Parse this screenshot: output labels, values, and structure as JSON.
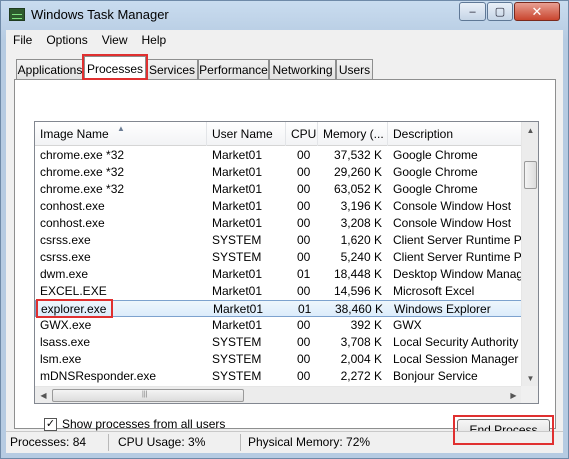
{
  "window": {
    "title": "Windows Task Manager"
  },
  "caption_buttons": {
    "minimize": "–",
    "maximize": "▢",
    "close": "✕"
  },
  "menu": [
    "File",
    "Options",
    "View",
    "Help"
  ],
  "tabs": [
    "Applications",
    "Processes",
    "Services",
    "Performance",
    "Networking",
    "Users"
  ],
  "active_tab": "Processes",
  "columns": [
    "Image Name",
    "User Name",
    "CPU",
    "Memory (...",
    "Description"
  ],
  "sort_indicator": "▲",
  "processes": [
    {
      "name": "chrome.exe *32",
      "user": "Market01",
      "cpu": "00",
      "memory": "37,532 K",
      "description": "Google Chrome"
    },
    {
      "name": "chrome.exe *32",
      "user": "Market01",
      "cpu": "00",
      "memory": "29,260 K",
      "description": "Google Chrome"
    },
    {
      "name": "chrome.exe *32",
      "user": "Market01",
      "cpu": "00",
      "memory": "63,052 K",
      "description": "Google Chrome"
    },
    {
      "name": "conhost.exe",
      "user": "Market01",
      "cpu": "00",
      "memory": "3,196 K",
      "description": "Console Window Host"
    },
    {
      "name": "conhost.exe",
      "user": "Market01",
      "cpu": "00",
      "memory": "3,208 K",
      "description": "Console Window Host"
    },
    {
      "name": "csrss.exe",
      "user": "SYSTEM",
      "cpu": "00",
      "memory": "1,620 K",
      "description": "Client Server Runtime Proce"
    },
    {
      "name": "csrss.exe",
      "user": "SYSTEM",
      "cpu": "00",
      "memory": "5,240 K",
      "description": "Client Server Runtime Proce"
    },
    {
      "name": "dwm.exe",
      "user": "Market01",
      "cpu": "01",
      "memory": "18,448 K",
      "description": "Desktop Window Manager"
    },
    {
      "name": "EXCEL.EXE",
      "user": "Market01",
      "cpu": "00",
      "memory": "14,596 K",
      "description": "Microsoft Excel"
    },
    {
      "name": "explorer.exe",
      "user": "Market01",
      "cpu": "01",
      "memory": "38,460 K",
      "description": "Windows Explorer",
      "selected": true
    },
    {
      "name": "GWX.exe",
      "user": "Market01",
      "cpu": "00",
      "memory": "392 K",
      "description": "GWX"
    },
    {
      "name": "lsass.exe",
      "user": "SYSTEM",
      "cpu": "00",
      "memory": "3,708 K",
      "description": "Local Security Authority Pro"
    },
    {
      "name": "lsm.exe",
      "user": "SYSTEM",
      "cpu": "00",
      "memory": "2,004 K",
      "description": "Local Session Manager Serv"
    },
    {
      "name": "mDNSResponder.exe",
      "user": "SYSTEM",
      "cpu": "00",
      "memory": "2,272 K",
      "description": "Bonjour Service"
    }
  ],
  "show_all_users": {
    "label": "Show processes from all users",
    "checked": true,
    "mark": "✓"
  },
  "end_process_label": "End Process",
  "status": {
    "processes": "Processes: 84",
    "cpu": "CPU Usage: 3%",
    "memory": "Physical Memory: 72%"
  },
  "colors": {
    "highlight": "#e03030",
    "selection": "#dcecfb"
  },
  "scroll_arrows": {
    "up": "▲",
    "down": "▼",
    "left": "◀",
    "right": "▶",
    "grip": "|||"
  }
}
